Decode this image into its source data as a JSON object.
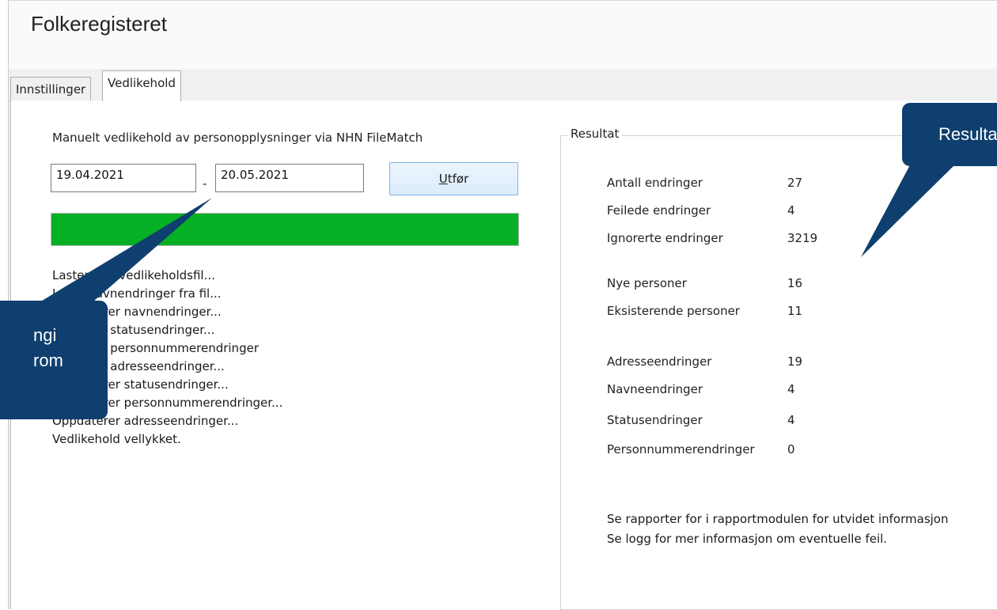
{
  "window": {
    "title": "Folkeregisteret"
  },
  "tabs": [
    {
      "label": "Innstillinger",
      "active": false
    },
    {
      "label": "Vedlikehold",
      "active": true
    }
  ],
  "maintenance": {
    "heading": "Manuelt vedlikehold av personopplysninger via NHN FileMatch",
    "date_from": "19.04.2021",
    "date_separator": "-",
    "date_to": "20.05.2021",
    "execute_button": {
      "underlined_char": "U",
      "rest": "tfør"
    },
    "progress_percent": 100,
    "progress_color": "#06b025",
    "log_lines": [
      "Laster ned vedlikeholdsfil...",
      "Leser navnendringer fra fil...",
      "Oppdaterer navnendringer...",
      "Leser inn statusendringer...",
      "Leser inn personnummerendringer",
      "Leser inn adresseendringer...",
      "Oppdaterer statusendringer...",
      "Oppdaterer personnummerendringer...",
      "Oppdaterer adresseendringer...",
      "Vedlikehold vellykket."
    ]
  },
  "result": {
    "group_title": "Resultat",
    "stats": [
      {
        "label": "Antall endringer",
        "value": "27"
      },
      {
        "label": "Feilede endringer",
        "value": "4"
      },
      {
        "label": "Ignorerte endringer",
        "value": "3219"
      },
      {
        "label": "Nye personer",
        "value": "16"
      },
      {
        "label": "Eksisterende personer",
        "value": "11"
      },
      {
        "label": "Adresseendringer",
        "value": "19"
      },
      {
        "label": "Navneendringer",
        "value": "4"
      },
      {
        "label": "Statusendringer",
        "value": "4"
      },
      {
        "label": "Personnummerendringer",
        "value": "0"
      }
    ],
    "notes": [
      "Se rapporter for i rapportmodulen for utvidet informasjon",
      "Se logg for mer informasjon om eventuelle feil."
    ]
  },
  "callouts": {
    "left_lines": [
      "ngi",
      "rom"
    ],
    "right_text": "Resulta",
    "color": "#0e3f6e"
  }
}
